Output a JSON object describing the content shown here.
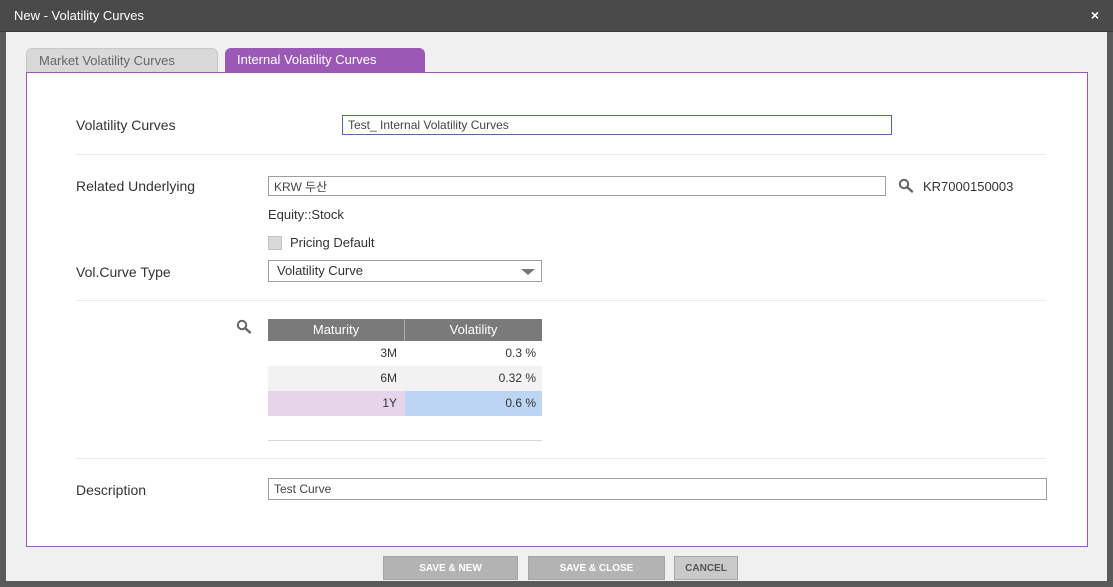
{
  "window": {
    "title": "New - Volatility Curves",
    "close_glyph": "×"
  },
  "tabs": [
    {
      "label": "Market Volatility Curves",
      "active": false
    },
    {
      "label": "Internal Volatility Curves",
      "active": true
    }
  ],
  "form": {
    "volatility_curves": {
      "label": "Volatility Curves",
      "value": "Test_ Internal Volatility Curves"
    },
    "related_underlying": {
      "label": "Related Underlying",
      "value": "KRW 두산",
      "code": "KR7000150003"
    },
    "asset_class": "Equity::Stock",
    "pricing_default": {
      "label": "Pricing Default",
      "checked": false
    },
    "vol_curve_type": {
      "label": "Vol.Curve Type",
      "selected": "Volatility Curve"
    },
    "description": {
      "label": "Description",
      "value": "Test Curve"
    }
  },
  "grid": {
    "columns": [
      "Maturity",
      "Volatility"
    ],
    "rows": [
      {
        "maturity": "3M",
        "volatility": "0.3 %"
      },
      {
        "maturity": "6M",
        "volatility": "0.32 %"
      },
      {
        "maturity": "1Y",
        "volatility": "0.6 %"
      }
    ]
  },
  "buttons": {
    "save_new": "SAVE & NEW",
    "save_close": "SAVE & CLOSE",
    "cancel": "CANCEL"
  },
  "colors": {
    "accent": "#9b59b6",
    "titlebar": "#4a4a4a",
    "selected_row_maturity": "#e6d5ea",
    "selected_row_volatility": "#bcd5f2"
  },
  "icons": [
    "search-icon",
    "close-icon",
    "chevron-down-icon"
  ]
}
